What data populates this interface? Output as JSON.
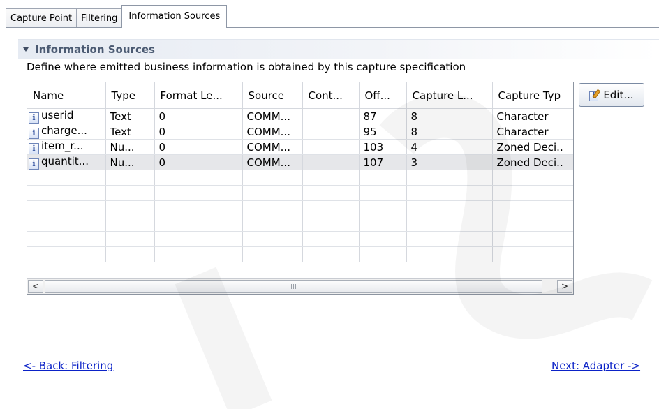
{
  "tabs": [
    {
      "label": "Capture Point",
      "active": false
    },
    {
      "label": "Filtering",
      "active": false
    },
    {
      "label": "Information Sources",
      "active": true
    }
  ],
  "section": {
    "title": "Information Sources",
    "description": "Define where emitted business information is obtained by this capture specification"
  },
  "table": {
    "columns": [
      "Name",
      "Type",
      "Format Le...",
      "Source",
      "Cont...",
      "Off...",
      "Capture L...",
      "Capture Typ"
    ],
    "rows": [
      {
        "icon": "info-icon",
        "name": "userid",
        "type": "Text",
        "format_length": "0",
        "source": "COMM...",
        "content": "",
        "offset": "87",
        "capture_length": "8",
        "capture_type": "Character",
        "selected": false
      },
      {
        "icon": "info-icon",
        "name": "charge...",
        "type": "Text",
        "format_length": "0",
        "source": "COMM...",
        "content": "",
        "offset": "95",
        "capture_length": "8",
        "capture_type": "Character",
        "selected": false
      },
      {
        "icon": "info-icon",
        "name": "item_r...",
        "type": "Nu...",
        "format_length": "0",
        "source": "COMM...",
        "content": "",
        "offset": "103",
        "capture_length": "4",
        "capture_type": "Zoned Deci..",
        "selected": false
      },
      {
        "icon": "info-icon",
        "name": "quantit...",
        "type": "Nu...",
        "format_length": "0",
        "source": "COMM...",
        "content": "",
        "offset": "107",
        "capture_length": "3",
        "capture_type": "Zoned Deci..",
        "selected": true
      }
    ],
    "empty_rows": 6
  },
  "icons": {
    "info_glyph": "i"
  },
  "scrollbar": {
    "left_arrow": "<",
    "right_arrow": ">"
  },
  "buttons": {
    "edit_label": "Edit..."
  },
  "navigation": {
    "back_label": "<- Back: Filtering",
    "next_label": "Next: Adapter ->"
  },
  "colors": {
    "link": "#0b22c7",
    "section_title": "#4b5a72",
    "selected_row": "#e6e7ea"
  }
}
